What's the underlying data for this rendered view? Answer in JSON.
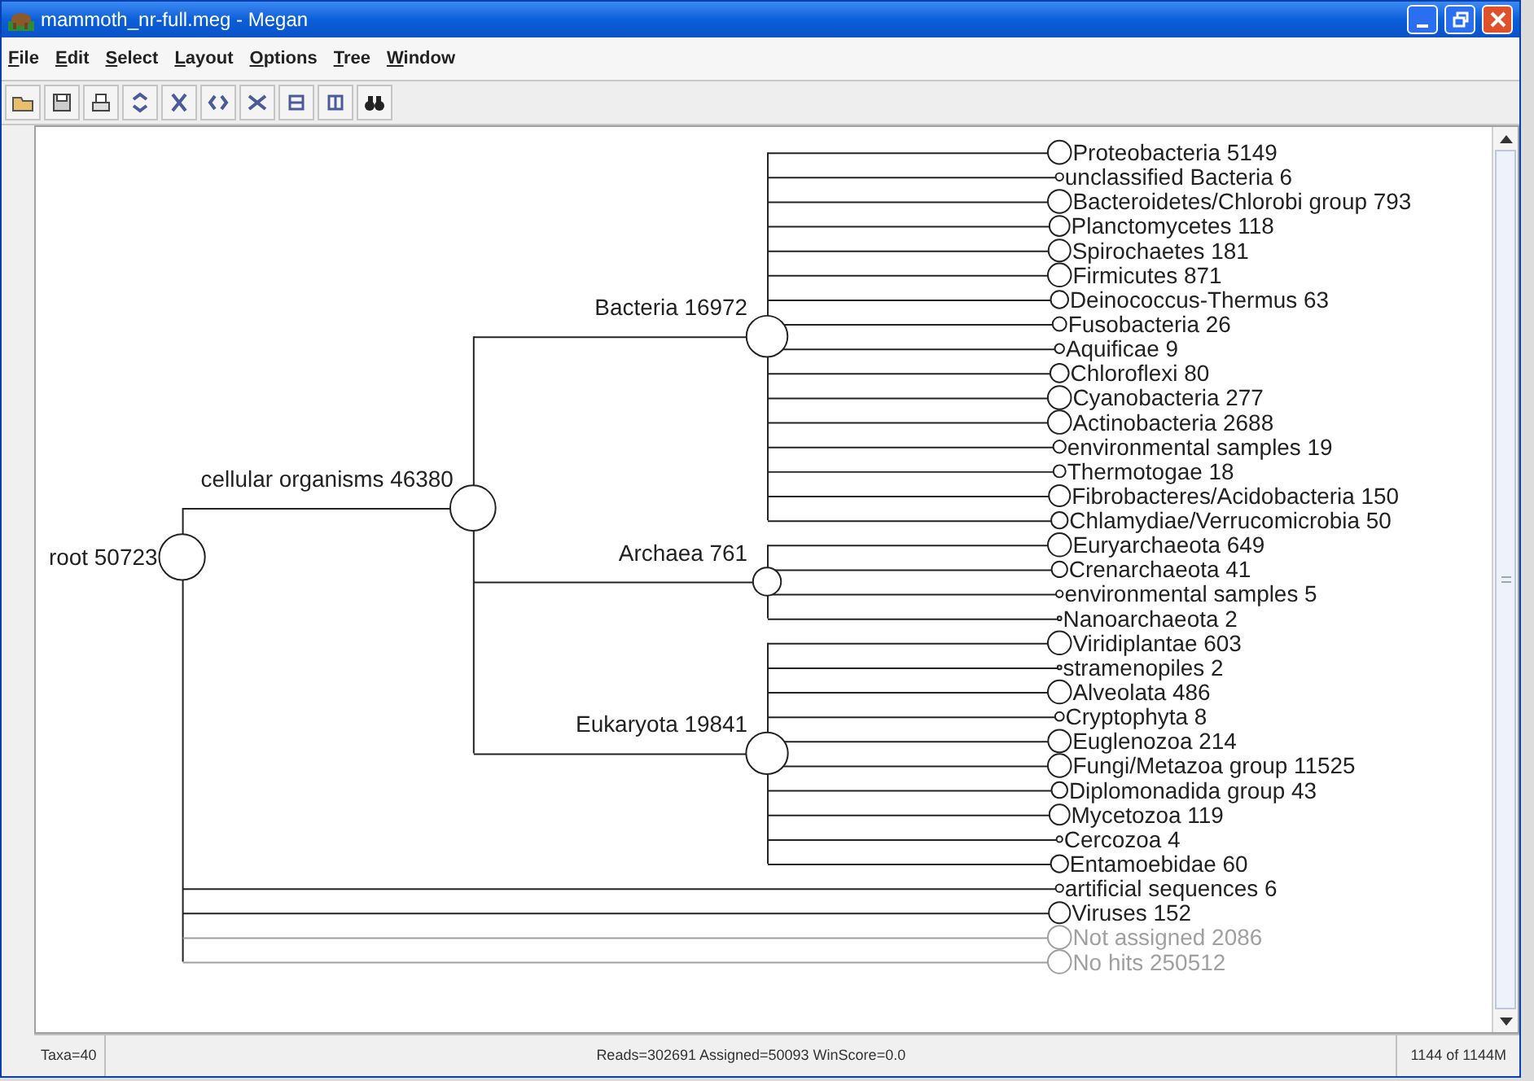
{
  "window": {
    "title": "mammoth_nr-full.meg - Megan"
  },
  "menu": [
    "File",
    "Edit",
    "Select",
    "Layout",
    "Options",
    "Tree",
    "Window"
  ],
  "tree": {
    "label": "root 50723",
    "children": [
      {
        "label": "cellular organisms 46380",
        "children": [
          {
            "label": "Bacteria 16972",
            "children": [
              {
                "label": "Proteobacteria 5149",
                "dimmed": false
              },
              {
                "label": "unclassified Bacteria 6",
                "dimmed": false
              },
              {
                "label": "Bacteroidetes/Chlorobi group 793",
                "dimmed": false
              },
              {
                "label": "Planctomycetes 118",
                "dimmed": false
              },
              {
                "label": "Spirochaetes 181",
                "dimmed": false
              },
              {
                "label": "Firmicutes 871",
                "dimmed": false
              },
              {
                "label": "Deinococcus-Thermus 63",
                "dimmed": false
              },
              {
                "label": "Fusobacteria 26",
                "dimmed": false
              },
              {
                "label": "Aquificae 9",
                "dimmed": false
              },
              {
                "label": "Chloroflexi 80",
                "dimmed": false
              },
              {
                "label": "Cyanobacteria 277",
                "dimmed": false
              },
              {
                "label": "Actinobacteria 2688",
                "dimmed": false
              },
              {
                "label": "environmental samples 19",
                "dimmed": false
              },
              {
                "label": "Thermotogae 18",
                "dimmed": false
              },
              {
                "label": "Fibrobacteres/Acidobacteria 150",
                "dimmed": false
              },
              {
                "label": "Chlamydiae/Verrucomicrobia 50",
                "dimmed": false
              }
            ]
          },
          {
            "label": "Archaea 761",
            "children": [
              {
                "label": "Euryarchaeota 649",
                "dimmed": false
              },
              {
                "label": "Crenarchaeota 41",
                "dimmed": false
              },
              {
                "label": "environmental samples 5",
                "dimmed": false
              },
              {
                "label": "Nanoarchaeota 2",
                "dimmed": false
              }
            ]
          },
          {
            "label": "Eukaryota 19841",
            "children": [
              {
                "label": "Viridiplantae 603",
                "dimmed": false
              },
              {
                "label": "stramenopiles 2",
                "dimmed": false
              },
              {
                "label": "Alveolata 486",
                "dimmed": false
              },
              {
                "label": "Cryptophyta 8",
                "dimmed": false
              },
              {
                "label": "Euglenozoa 214",
                "dimmed": false
              },
              {
                "label": "Fungi/Metazoa group 11525",
                "dimmed": false
              },
              {
                "label": "Diplomonadida group 43",
                "dimmed": false
              },
              {
                "label": "Mycetozoa 119",
                "dimmed": false
              },
              {
                "label": "Cercozoa 4",
                "dimmed": false
              },
              {
                "label": "Entamoebidae 60",
                "dimmed": false
              }
            ]
          }
        ]
      },
      {
        "label": "artificial sequences 6",
        "dimmed": false
      },
      {
        "label": "Viruses 152",
        "dimmed": false
      },
      {
        "label": "Not assigned 2086",
        "dimmed": true
      },
      {
        "label": "No hits 250512",
        "dimmed": true
      }
    ]
  },
  "status_bar": {
    "taxa": "Taxa=40",
    "summary": "Reads=302691 Assigned=50093 WinScore=0.0",
    "memory": "1144 of 1144M"
  }
}
